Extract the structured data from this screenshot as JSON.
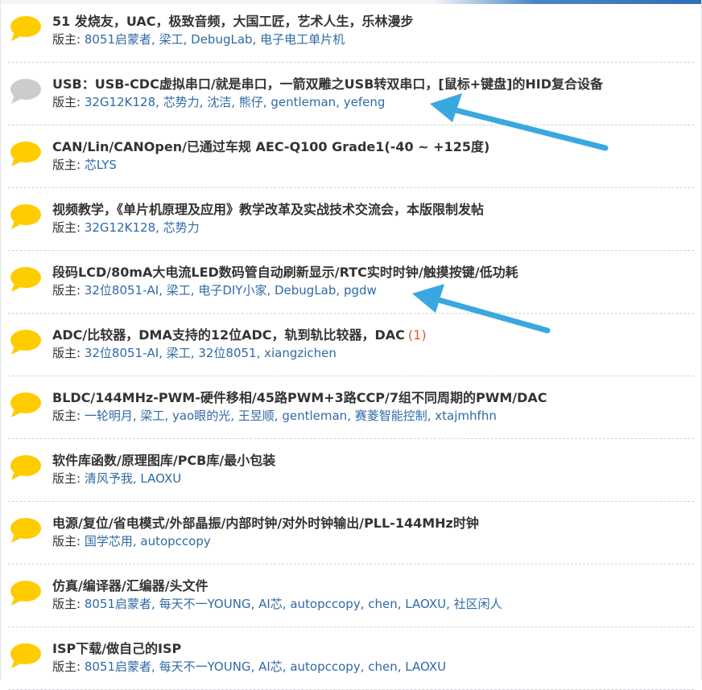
{
  "moderator_label": "版主:",
  "colors": {
    "title": "#333333",
    "moderator_link": "#2f6aa5",
    "new_count": "#e05a2b",
    "icon_active": "#ffcc00",
    "icon_inactive": "#cccccc",
    "arrow": "#3aa8e0"
  },
  "forums": [
    {
      "icon": "speech-bubble-yellow",
      "title": "51 发烧友，UAC，极致音频，大国工匠，艺术人生，乐林漫步",
      "new_count": "",
      "moderators": [
        "8051启蒙者",
        "梁工",
        "DebugLab",
        "电子电工单片机"
      ]
    },
    {
      "icon": "speech-bubble-gray",
      "title": "USB：USB-CDC虚拟串口/就是串口，一箭双雕之USB转双串口，[鼠标+键盘]的HID复合设备",
      "new_count": "",
      "moderators": [
        "32G12K128",
        "芯势力",
        "沈洁",
        "熊仔",
        "gentleman",
        "yefeng"
      ]
    },
    {
      "icon": "speech-bubble-yellow",
      "title": "CAN/Lin/CANOpen/已通过车规 AEC-Q100 Grade1(-40 ~ +125度)",
      "new_count": "",
      "moderators": [
        "芯LYS"
      ]
    },
    {
      "icon": "speech-bubble-yellow",
      "title": "视频教学，《单片机原理及应用》教学改革及实战技术交流会，本版限制发帖",
      "new_count": "",
      "moderators": [
        "32G12K128",
        "芯势力"
      ]
    },
    {
      "icon": "speech-bubble-yellow",
      "title": "段码LCD/80mA大电流LED数码管自动刷新显示/RTC实时时钟/触摸按键/低功耗",
      "new_count": "",
      "moderators": [
        "32位8051-AI",
        "梁工",
        "电子DIY小家",
        "DebugLab",
        "pgdw"
      ]
    },
    {
      "icon": "speech-bubble-yellow",
      "title": "ADC/比较器，DMA支持的12位ADC，轨到轨比较器，DAC",
      "new_count": "(1)",
      "moderators": [
        "32位8051-AI",
        "梁工",
        "32位8051",
        "xiangzichen"
      ]
    },
    {
      "icon": "speech-bubble-yellow",
      "title": "BLDC/144MHz-PWM-硬件移相/45路PWM+3路CCP/7组不同周期的PWM/DAC",
      "new_count": "",
      "moderators": [
        "一轮明月",
        "梁工",
        "yao眼的光",
        "王昱顺",
        "gentleman",
        "赛菱智能控制",
        "xtajmhfhn"
      ]
    },
    {
      "icon": "speech-bubble-yellow",
      "title": "软件库函数/原理图库/PCB库/最小包装",
      "new_count": "",
      "moderators": [
        "清风予我",
        "LAOXU"
      ]
    },
    {
      "icon": "speech-bubble-yellow",
      "title": "电源/复位/省电模式/外部晶振/内部时钟/对外时钟输出/PLL-144MHz时钟",
      "new_count": "",
      "moderators": [
        "国学芯用",
        "autopccopy"
      ]
    },
    {
      "icon": "speech-bubble-yellow",
      "title": "仿真/编译器/汇编器/头文件",
      "new_count": "",
      "moderators": [
        "8051启蒙者",
        "每天不一YOUNG",
        "AI芯",
        "autopccopy",
        "chen",
        "LAOXU",
        "社区闲人"
      ]
    },
    {
      "icon": "speech-bubble-yellow",
      "title": "ISP下载/做自己的ISP",
      "new_count": "",
      "moderators": [
        "8051启蒙者",
        "每天不一YOUNG",
        "AI芯",
        "autopccopy",
        "chen",
        "LAOXU"
      ]
    }
  ]
}
